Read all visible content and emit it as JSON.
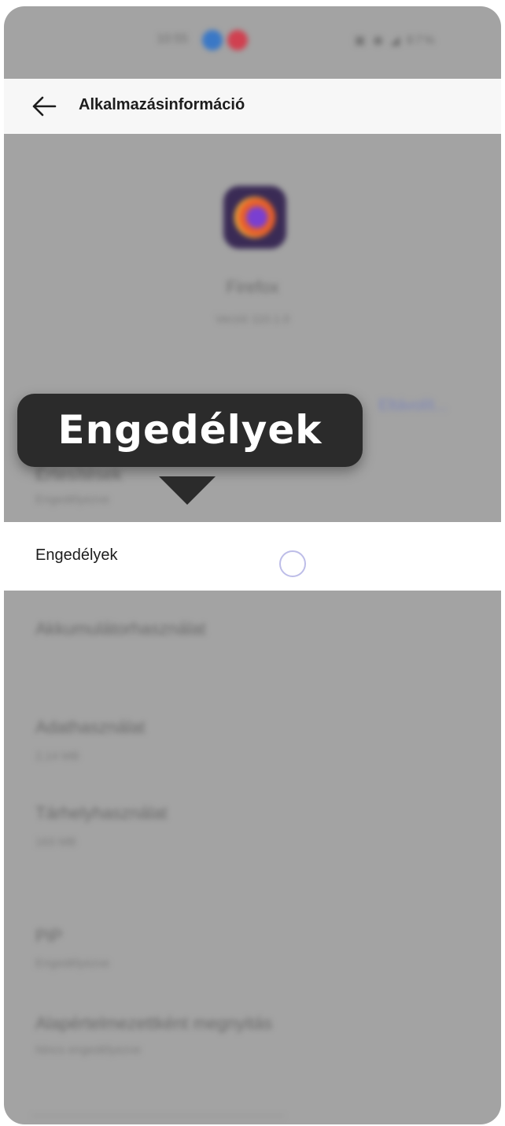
{
  "status_bar": {
    "time": "10:55",
    "right_icons": "▣ ◉ ◢ 87%"
  },
  "header": {
    "title": "Alkalmazásinformáció"
  },
  "app": {
    "name": "Firefox",
    "version": "Verzió 110.1.0"
  },
  "actions": {
    "right_link": "Eltávolít..."
  },
  "tooltip": {
    "text": "Engedélyek"
  },
  "permissions_row": {
    "label": "Engedélyek"
  },
  "rows": [
    {
      "title": "Értesítések",
      "subtitle": "Engedélyezve"
    },
    {
      "title": "Akkumulátorhasználat",
      "subtitle": ""
    },
    {
      "title": "Adathasználat",
      "subtitle": "2,14 MB"
    },
    {
      "title": "Tárhelyhasználat",
      "subtitle": "163 MB"
    },
    {
      "title": "PiP",
      "subtitle": "Engedélyezve"
    },
    {
      "title": "Alapértelmezettként megnyitás",
      "subtitle": "Nincs engedélyezve"
    }
  ],
  "colors": {
    "dim_background": "#a3a3a3",
    "tooltip_bg": "#2b2b2b",
    "tap_indicator": "#bdbde8"
  },
  "icons": {
    "back": "arrow-left-icon",
    "app": "firefox-app-icon",
    "tap": "tap-indicator-circle"
  }
}
